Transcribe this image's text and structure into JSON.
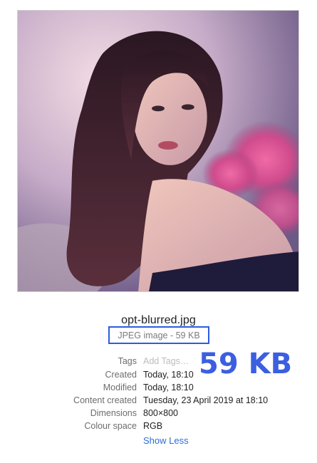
{
  "file": {
    "name": "opt-blurred.jpg",
    "kind_size": "JPEG image - 59 KB"
  },
  "callout": {
    "size": "59 KB",
    "color": "#3b5fe0"
  },
  "highlight_color": "#2d5be3",
  "info_rows": [
    {
      "label": "Tags",
      "value": "Add Tags…",
      "placeholder": true
    },
    {
      "label": "Created",
      "value": "Today, 18:10"
    },
    {
      "label": "Modified",
      "value": "Today, 18:10"
    },
    {
      "label": "Content created",
      "value": "Tuesday, 23 April 2019 at 18:10"
    },
    {
      "label": "Dimensions",
      "value": "800×800"
    },
    {
      "label": "Colour space",
      "value": "RGB"
    }
  ],
  "show_less_label": "Show Less"
}
